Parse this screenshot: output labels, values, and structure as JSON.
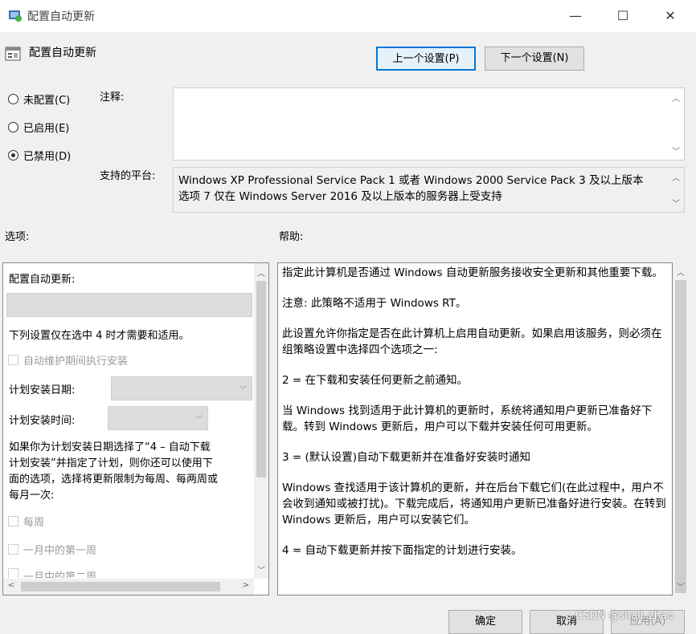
{
  "window": {
    "title": "配置自动更新"
  },
  "header": {
    "policy_name": "配置自动更新"
  },
  "nav": {
    "prev_label": "上一个设置(P)",
    "next_label": "下一个设置(N)"
  },
  "state": {
    "options": [
      {
        "label": "未配置(C)",
        "checked": false
      },
      {
        "label": "已启用(E)",
        "checked": false
      },
      {
        "label": "已禁用(D)",
        "checked": true
      }
    ]
  },
  "comment": {
    "label": "注释:",
    "value": ""
  },
  "platform": {
    "label": "支持的平台:",
    "line1": "Windows XP Professional Service Pack 1 或者 Windows 2000 Service Pack 3 及以上版本",
    "line2": "选项 7 仅在 Windows Server 2016 及以上版本的服务器上受支持"
  },
  "sections": {
    "options_label": "选项:",
    "help_label": "帮助:"
  },
  "options_panel": {
    "configure_label": "配置自动更新:",
    "note": "下列设置仅在选中 4 时才需要和适用。",
    "maintenance_label": "自动维护期间执行安装",
    "install_day_label": "计划安装日期:",
    "install_time_label": "计划安装时间:",
    "schedule_text_1": "如果你为计划安装日期选择了“4 – 自动下载",
    "schedule_text_2": "计划安装”并指定了计划，则你还可以使用下",
    "schedule_text_3": "面的选项，选择将更新限制为每周、每两周或",
    "schedule_text_4": "每月一次:",
    "weekly_label": "每周",
    "first_week_label": "一月中的第一周",
    "second_week_label": "一月中的第二周"
  },
  "help_panel": {
    "p1": "指定此计算机是否通过 Windows 自动更新服务接收安全更新和其他重要下载。",
    "p2": "注意: 此策略不适用于 Windows RT。",
    "p3": "此设置允许你指定是否在此计算机上启用自动更新。如果启用该服务，则必须在组策略设置中选择四个选项之一:",
    "p4": " 2 = 在下载和安装任何更新之前通知。",
    "p5": " 当 Windows 找到适用于此计算机的更新时，系统将通知用户更新已准备好下载。转到 Windows 更新后，用户可以下载并安装任何可用更新。",
    "p6": " 3 = (默认设置)自动下载更新并在准备好安装时通知",
    "p7": " Windows 查找适用于该计算机的更新，并在后台下载它们(在此过程中，用户不会收到通知或被打扰)。下载完成后，将通知用户更新已准备好进行安装。在转到 Windows 更新后，用户可以安装它们。",
    "p8": " 4 = 自动下载更新并按下面指定的计划进行安装。"
  },
  "footer": {
    "ok_label": "确定",
    "cancel_label": "取消",
    "apply_label": "应用(A)",
    "watermark": "CSDN @shall_zhao"
  }
}
